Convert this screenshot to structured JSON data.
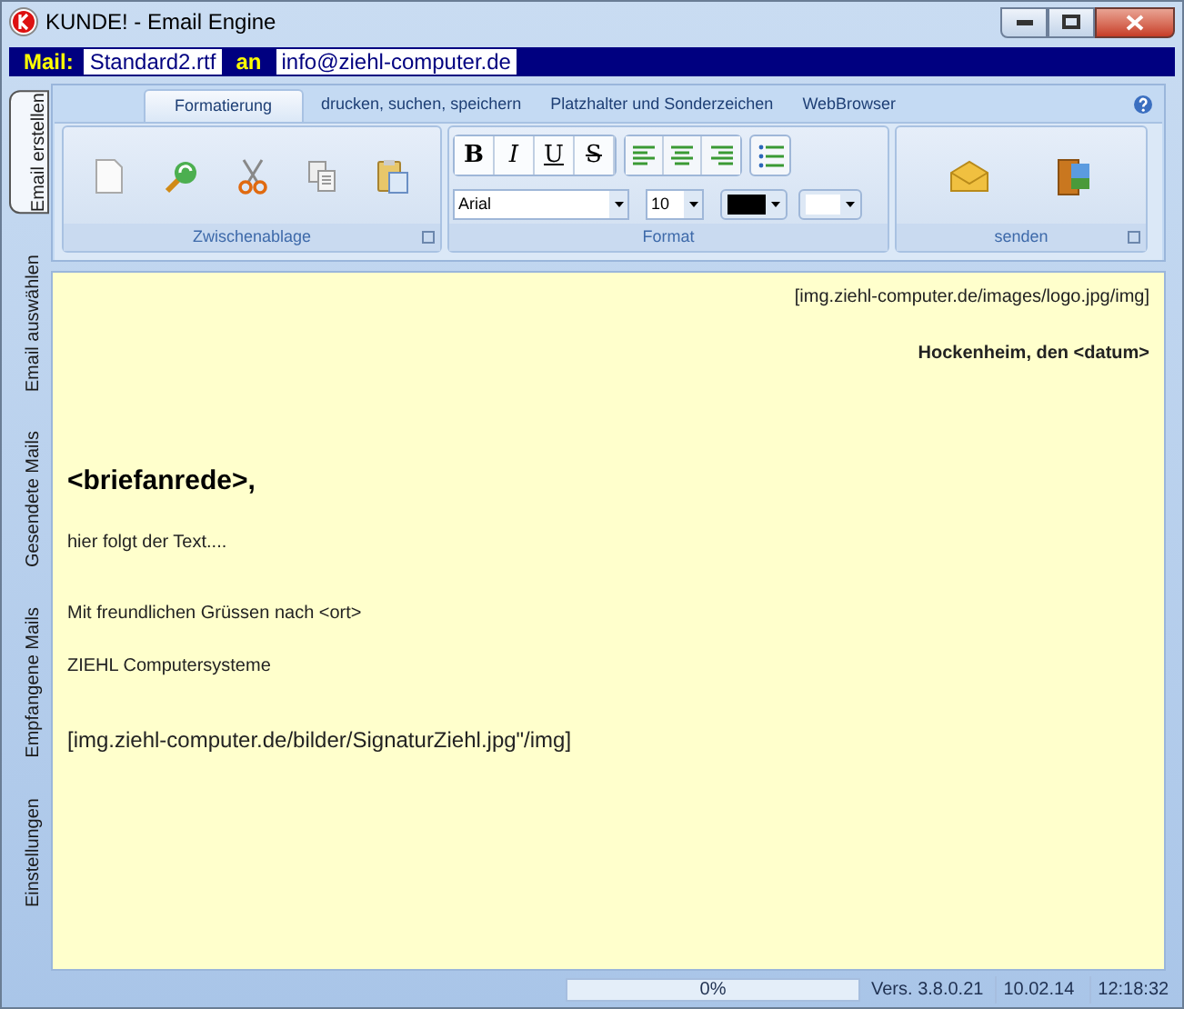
{
  "window": {
    "title": "KUNDE! - Email Engine"
  },
  "mail_bar": {
    "label": "Mail:",
    "template": "Standard2.rtf",
    "connector": "an",
    "recipient": "info@ziehl-computer.de"
  },
  "side_tabs": [
    {
      "label": "Email erstellen",
      "selected": true
    },
    {
      "label": "Email auswählen",
      "selected": false
    },
    {
      "label": "Gesendete Mails",
      "selected": false
    },
    {
      "label": "Empfangene Mails",
      "selected": false
    },
    {
      "label": "Einstellungen",
      "selected": false
    }
  ],
  "ribbon_tabs": [
    {
      "label": "Formatierung",
      "selected": true
    },
    {
      "label": "drucken, suchen, speichern",
      "selected": false
    },
    {
      "label": "Platzhalter und Sonderzeichen",
      "selected": false
    },
    {
      "label": "WebBrowser",
      "selected": false
    }
  ],
  "groups": {
    "clipboard": "Zwischenablage",
    "format": "Format",
    "send": "senden"
  },
  "format_buttons": [
    "B",
    "I",
    "U",
    "S"
  ],
  "font": {
    "family": "Arial",
    "size": "10"
  },
  "color_pickers": [
    {
      "color": "#000000"
    },
    {
      "color": "#ffffff"
    }
  ],
  "document": [
    {
      "kind": "right",
      "text": "[img.ziehl-computer.de/images/logo.jpg/img]"
    },
    {
      "kind": "right-bold",
      "text": "Hockenheim, den <datum>"
    },
    {
      "kind": "heading",
      "text": "<briefanrede>,"
    },
    {
      "kind": "body",
      "text": "hier folgt der Text...."
    },
    {
      "kind": "body",
      "text": "Mit freundlichen Grüssen nach <ort>"
    },
    {
      "kind": "body",
      "text": "ZIEHL Computersysteme"
    },
    {
      "kind": "large",
      "text": "[img.ziehl-computer.de/bilder/SignaturZiehl.jpg\"/img]"
    }
  ],
  "status_bar": {
    "progress": "0%",
    "level": 0,
    "version": "Vers. 3.8.0.21",
    "date": "10.02.14",
    "time": "12:18:32"
  }
}
